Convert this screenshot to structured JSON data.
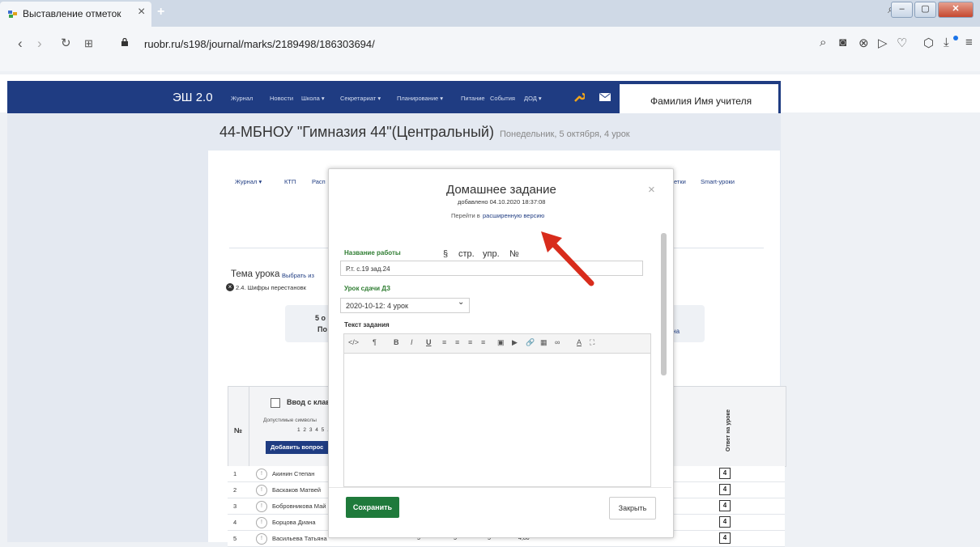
{
  "browser": {
    "tab_title": "Выставление отметок",
    "url": "ruobr.ru/s198/journal/marks/2189498/186303694/"
  },
  "nav": {
    "brand": "ЭШ 2.0",
    "items": [
      "Журнал",
      "Новости",
      "Школа ▾",
      "Секретариат ▾",
      "Планирование ▾",
      "Питание",
      "События",
      "ДОД ▾"
    ],
    "user": "Фамилия Имя учителя"
  },
  "page": {
    "school": "44-МБНОУ \"Гимназия 44\"(Центральный)",
    "lesson": "Понедельник, 5 октября, 4 урок",
    "subnav": [
      "Журнал ▾",
      "КТП",
      "Расп",
      "етки",
      "Smart-уроки"
    ],
    "topic_label": "Тема урока",
    "topic_choose": "Выбрать из",
    "topic_item": "2.4. Шифры перестановк",
    "date_line1": "5 о",
    "date_line2": "По",
    "date_name": "аевна",
    "keyboard_label": "Ввод с клав",
    "allowed_label": "Допустимые символы",
    "allowed_values": "1 2 3 4 5 . -",
    "add_question": "Добавить вопрос",
    "num_header": "№",
    "answer_header": "Ответ на уроке"
  },
  "students": [
    {
      "num": "1",
      "name": "Акинин Степан",
      "mark": "4"
    },
    {
      "num": "2",
      "name": "Баскаков Матвей",
      "mark": "4"
    },
    {
      "num": "3",
      "name": "Бобровникова Май",
      "mark": "4"
    },
    {
      "num": "4",
      "name": "Борцова Диана",
      "mark": "4"
    },
    {
      "num": "5",
      "name": "Васильева Татьяна",
      "mark": "4",
      "v1": "5",
      "v2": "5",
      "v3": "5",
      "avg": "4,80"
    }
  ],
  "modal": {
    "title": "Домашнее задание",
    "added": "добавлено 04.10.2020 18:37:08",
    "link_prefix": "Перейти в",
    "link_text": "расширенную версию",
    "work_name_label": "Название работы",
    "section_sign": "§",
    "page_label": "стр.",
    "exercise_label": "упр.",
    "number_label": "№",
    "work_name_value": "Р.т. с.19 зад.24",
    "due_label": "Урок сдачи ДЗ",
    "due_value": "2020-10-12: 4 урок",
    "text_label": "Текст задания",
    "toolbar": [
      "</>",
      "¶",
      "B",
      "I",
      "U",
      "≡",
      "≡",
      "≡",
      "≡",
      "▣",
      "▶",
      "🔗",
      "▦",
      "∞",
      "A",
      "⛶"
    ],
    "save": "Сохранить",
    "close": "Закрыть"
  }
}
